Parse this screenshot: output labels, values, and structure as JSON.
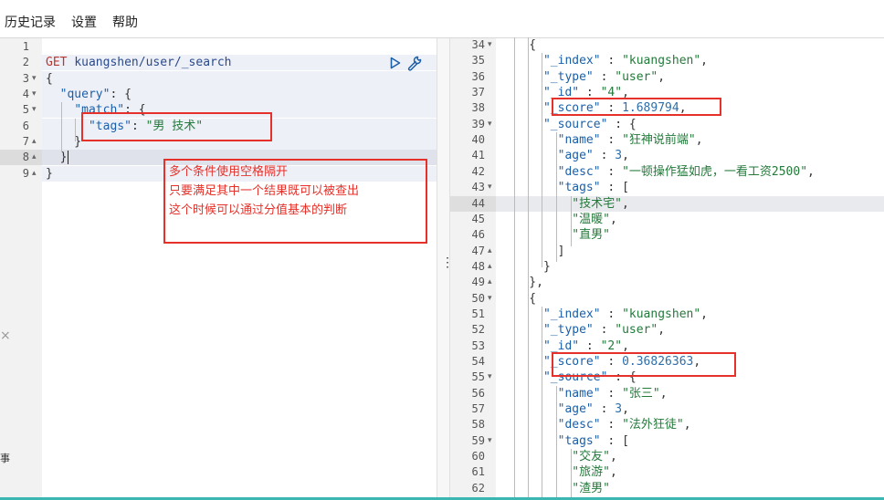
{
  "menu": [
    "历史记录",
    "设置",
    "帮助"
  ],
  "request": {
    "lines": [
      {
        "n": "1",
        "fold": "",
        "tokens": []
      },
      {
        "n": "2",
        "fold": "",
        "tokens": [
          {
            "t": "GET ",
            "c": "m"
          },
          {
            "t": "kuangshen/user/_search",
            "c": "u"
          }
        ]
      },
      {
        "n": "3",
        "fold": "▾",
        "tokens": [
          {
            "t": "{",
            "c": "p"
          }
        ]
      },
      {
        "n": "4",
        "fold": "▾",
        "tokens": [
          {
            "t": "  ",
            "c": "p"
          },
          {
            "t": "\"query\"",
            "c": "k"
          },
          {
            "t": ": {",
            "c": "p"
          }
        ]
      },
      {
        "n": "5",
        "fold": "▾",
        "tokens": [
          {
            "t": "    ",
            "c": "p"
          },
          {
            "t": "\"match\"",
            "c": "k"
          },
          {
            "t": ": {",
            "c": "p"
          }
        ]
      },
      {
        "n": "6",
        "fold": "",
        "tokens": [
          {
            "t": "      ",
            "c": "p"
          },
          {
            "t": "\"tags\"",
            "c": "k"
          },
          {
            "t": ": ",
            "c": "p"
          },
          {
            "t": "\"男 技术\"",
            "c": "s"
          }
        ]
      },
      {
        "n": "7",
        "fold": "▴",
        "tokens": [
          {
            "t": "    }",
            "c": "p"
          }
        ]
      },
      {
        "n": "8",
        "fold": "▴",
        "tokens": [
          {
            "t": "  }",
            "c": "p"
          }
        ]
      },
      {
        "n": "9",
        "fold": "▴",
        "tokens": [
          {
            "t": "}",
            "c": "p"
          }
        ]
      }
    ]
  },
  "annotation": [
    "多个条件使用空格隔开",
    "只要满足其中一个结果既可以被查出",
    "这个时候可以通过分值基本的判断"
  ],
  "response": {
    "lines": [
      {
        "n": "34",
        "fold": "▾",
        "tokens": [
          {
            "t": "    {",
            "c": "p"
          }
        ]
      },
      {
        "n": "35",
        "fold": "",
        "tokens": [
          {
            "t": "      ",
            "c": "p"
          },
          {
            "t": "\"_index\"",
            "c": "k"
          },
          {
            "t": " : ",
            "c": "p"
          },
          {
            "t": "\"kuangshen\"",
            "c": "s"
          },
          {
            "t": ",",
            "c": "p"
          }
        ]
      },
      {
        "n": "36",
        "fold": "",
        "tokens": [
          {
            "t": "      ",
            "c": "p"
          },
          {
            "t": "\"_type\"",
            "c": "k"
          },
          {
            "t": " : ",
            "c": "p"
          },
          {
            "t": "\"user\"",
            "c": "s"
          },
          {
            "t": ",",
            "c": "p"
          }
        ]
      },
      {
        "n": "37",
        "fold": "",
        "tokens": [
          {
            "t": "      ",
            "c": "p"
          },
          {
            "t": "\"_id\"",
            "c": "k"
          },
          {
            "t": " : ",
            "c": "p"
          },
          {
            "t": "\"4\"",
            "c": "s"
          },
          {
            "t": ",",
            "c": "p"
          }
        ]
      },
      {
        "n": "38",
        "fold": "",
        "tokens": [
          {
            "t": "      ",
            "c": "p"
          },
          {
            "t": "\"_score\"",
            "c": "k"
          },
          {
            "t": " : ",
            "c": "p"
          },
          {
            "t": "1.689794",
            "c": "n"
          },
          {
            "t": ",",
            "c": "p"
          }
        ]
      },
      {
        "n": "39",
        "fold": "▾",
        "tokens": [
          {
            "t": "      ",
            "c": "p"
          },
          {
            "t": "\"_source\"",
            "c": "k"
          },
          {
            "t": " : {",
            "c": "p"
          }
        ]
      },
      {
        "n": "40",
        "fold": "",
        "tokens": [
          {
            "t": "        ",
            "c": "p"
          },
          {
            "t": "\"name\"",
            "c": "k"
          },
          {
            "t": " : ",
            "c": "p"
          },
          {
            "t": "\"狂神说前端\"",
            "c": "s"
          },
          {
            "t": ",",
            "c": "p"
          }
        ]
      },
      {
        "n": "41",
        "fold": "",
        "tokens": [
          {
            "t": "        ",
            "c": "p"
          },
          {
            "t": "\"age\"",
            "c": "k"
          },
          {
            "t": " : ",
            "c": "p"
          },
          {
            "t": "3",
            "c": "n"
          },
          {
            "t": ",",
            "c": "p"
          }
        ]
      },
      {
        "n": "42",
        "fold": "",
        "tokens": [
          {
            "t": "        ",
            "c": "p"
          },
          {
            "t": "\"desc\"",
            "c": "k"
          },
          {
            "t": " : ",
            "c": "p"
          },
          {
            "t": "\"一顿操作猛如虎，一看工资2500\"",
            "c": "s"
          },
          {
            "t": ",",
            "c": "p"
          }
        ]
      },
      {
        "n": "43",
        "fold": "▾",
        "tokens": [
          {
            "t": "        ",
            "c": "p"
          },
          {
            "t": "\"tags\"",
            "c": "k"
          },
          {
            "t": " : [",
            "c": "p"
          }
        ]
      },
      {
        "n": "44",
        "fold": "",
        "tokens": [
          {
            "t": "          ",
            "c": "p"
          },
          {
            "t": "\"技术宅\"",
            "c": "s"
          },
          {
            "t": ",",
            "c": "p"
          }
        ]
      },
      {
        "n": "45",
        "fold": "",
        "tokens": [
          {
            "t": "          ",
            "c": "p"
          },
          {
            "t": "\"温暖\"",
            "c": "s"
          },
          {
            "t": ",",
            "c": "p"
          }
        ]
      },
      {
        "n": "46",
        "fold": "",
        "tokens": [
          {
            "t": "          ",
            "c": "p"
          },
          {
            "t": "\"直男\"",
            "c": "s"
          }
        ]
      },
      {
        "n": "47",
        "fold": "▴",
        "tokens": [
          {
            "t": "        ]",
            "c": "p"
          }
        ]
      },
      {
        "n": "48",
        "fold": "▴",
        "tokens": [
          {
            "t": "      }",
            "c": "p"
          }
        ]
      },
      {
        "n": "49",
        "fold": "▴",
        "tokens": [
          {
            "t": "    },",
            "c": "p"
          }
        ]
      },
      {
        "n": "50",
        "fold": "▾",
        "tokens": [
          {
            "t": "    {",
            "c": "p"
          }
        ]
      },
      {
        "n": "51",
        "fold": "",
        "tokens": [
          {
            "t": "      ",
            "c": "p"
          },
          {
            "t": "\"_index\"",
            "c": "k"
          },
          {
            "t": " : ",
            "c": "p"
          },
          {
            "t": "\"kuangshen\"",
            "c": "s"
          },
          {
            "t": ",",
            "c": "p"
          }
        ]
      },
      {
        "n": "52",
        "fold": "",
        "tokens": [
          {
            "t": "      ",
            "c": "p"
          },
          {
            "t": "\"_type\"",
            "c": "k"
          },
          {
            "t": " : ",
            "c": "p"
          },
          {
            "t": "\"user\"",
            "c": "s"
          },
          {
            "t": ",",
            "c": "p"
          }
        ]
      },
      {
        "n": "53",
        "fold": "",
        "tokens": [
          {
            "t": "      ",
            "c": "p"
          },
          {
            "t": "\"_id\"",
            "c": "k"
          },
          {
            "t": " : ",
            "c": "p"
          },
          {
            "t": "\"2\"",
            "c": "s"
          },
          {
            "t": ",",
            "c": "p"
          }
        ]
      },
      {
        "n": "54",
        "fold": "",
        "tokens": [
          {
            "t": "      ",
            "c": "p"
          },
          {
            "t": "\"_score\"",
            "c": "k"
          },
          {
            "t": " : ",
            "c": "p"
          },
          {
            "t": "0.36826363",
            "c": "n"
          },
          {
            "t": ",",
            "c": "p"
          }
        ]
      },
      {
        "n": "55",
        "fold": "▾",
        "tokens": [
          {
            "t": "      ",
            "c": "p"
          },
          {
            "t": "\"_source\"",
            "c": "k"
          },
          {
            "t": " : {",
            "c": "p"
          }
        ]
      },
      {
        "n": "56",
        "fold": "",
        "tokens": [
          {
            "t": "        ",
            "c": "p"
          },
          {
            "t": "\"name\"",
            "c": "k"
          },
          {
            "t": " : ",
            "c": "p"
          },
          {
            "t": "\"张三\"",
            "c": "s"
          },
          {
            "t": ",",
            "c": "p"
          }
        ]
      },
      {
        "n": "57",
        "fold": "",
        "tokens": [
          {
            "t": "        ",
            "c": "p"
          },
          {
            "t": "\"age\"",
            "c": "k"
          },
          {
            "t": " : ",
            "c": "p"
          },
          {
            "t": "3",
            "c": "n"
          },
          {
            "t": ",",
            "c": "p"
          }
        ]
      },
      {
        "n": "58",
        "fold": "",
        "tokens": [
          {
            "t": "        ",
            "c": "p"
          },
          {
            "t": "\"desc\"",
            "c": "k"
          },
          {
            "t": " : ",
            "c": "p"
          },
          {
            "t": "\"法外狂徒\"",
            "c": "s"
          },
          {
            "t": ",",
            "c": "p"
          }
        ]
      },
      {
        "n": "59",
        "fold": "▾",
        "tokens": [
          {
            "t": "        ",
            "c": "p"
          },
          {
            "t": "\"tags\"",
            "c": "k"
          },
          {
            "t": " : [",
            "c": "p"
          }
        ]
      },
      {
        "n": "60",
        "fold": "",
        "tokens": [
          {
            "t": "          ",
            "c": "p"
          },
          {
            "t": "\"交友\"",
            "c": "s"
          },
          {
            "t": ",",
            "c": "p"
          }
        ]
      },
      {
        "n": "61",
        "fold": "",
        "tokens": [
          {
            "t": "          ",
            "c": "p"
          },
          {
            "t": "\"旅游\"",
            "c": "s"
          },
          {
            "t": ",",
            "c": "p"
          }
        ]
      },
      {
        "n": "62",
        "fold": "",
        "tokens": [
          {
            "t": "          ",
            "c": "p"
          },
          {
            "t": "\"渣男\"",
            "c": "s"
          }
        ]
      }
    ]
  },
  "sidebar_glyphs": {
    "close": "×",
    "partial": "事"
  },
  "icons": {
    "play": "play-icon",
    "wrench": "wrench-icon"
  },
  "colors": {
    "annotation": "#e5312a",
    "string": "#237a3a",
    "key": "#1b5fa8",
    "method": "#b5382f"
  }
}
